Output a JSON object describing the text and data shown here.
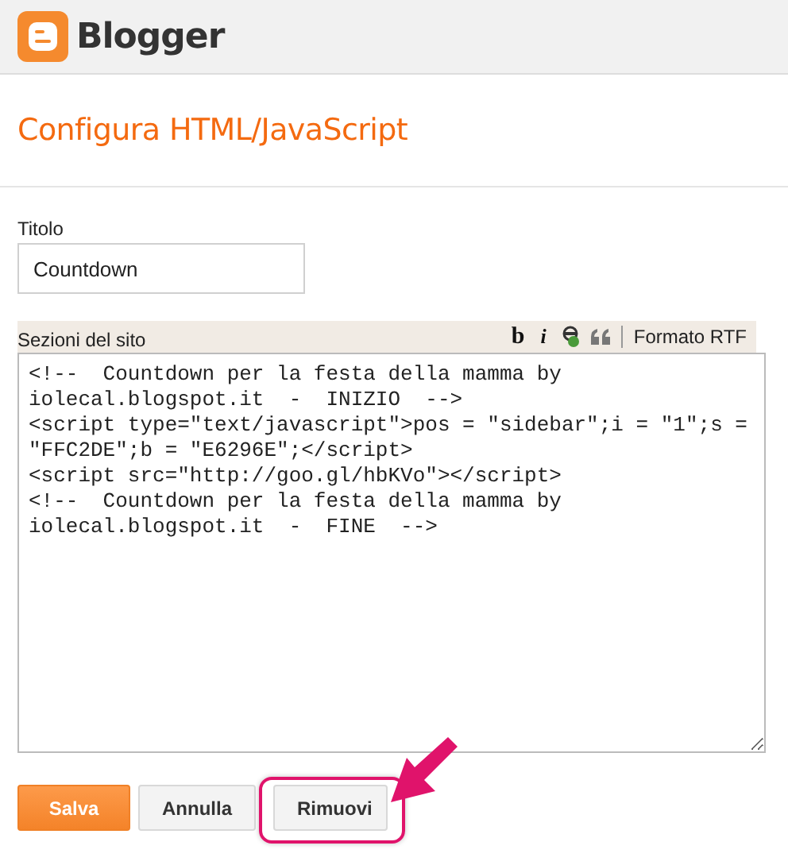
{
  "header": {
    "logo_text": "Blogger"
  },
  "page_title": "Configura HTML/JavaScript",
  "title_field": {
    "label": "Titolo",
    "value": "Countdown"
  },
  "content_field": {
    "label": "Sezioni del sito",
    "toolbar": [
      {
        "kind": "bold",
        "label": "b"
      },
      {
        "kind": "italic",
        "label": "i"
      },
      {
        "kind": "link"
      },
      {
        "kind": "quote"
      },
      {
        "kind": "text",
        "label": "Formato RTF"
      }
    ],
    "value": "<!--  Countdown per la festa della mamma by iolecal.blogspot.it  -  INIZIO  -->\n<script type=\"text/javascript\">pos = \"sidebar\";i = \"1\";s = \"FFC2DE\";b = \"E6296E\";</script>\n<script src=\"http://goo.gl/hbKVo\"></script>\n<!--  Countdown per la festa della mamma by iolecal.blogspot.it  -  FINE  -->"
  },
  "buttons": [
    {
      "label": "Salva",
      "kind": "primary",
      "highlighted": false
    },
    {
      "label": "Annulla",
      "kind": "secondary",
      "highlighted": false
    },
    {
      "label": "Rimuovi",
      "kind": "secondary",
      "highlighted": true
    }
  ]
}
